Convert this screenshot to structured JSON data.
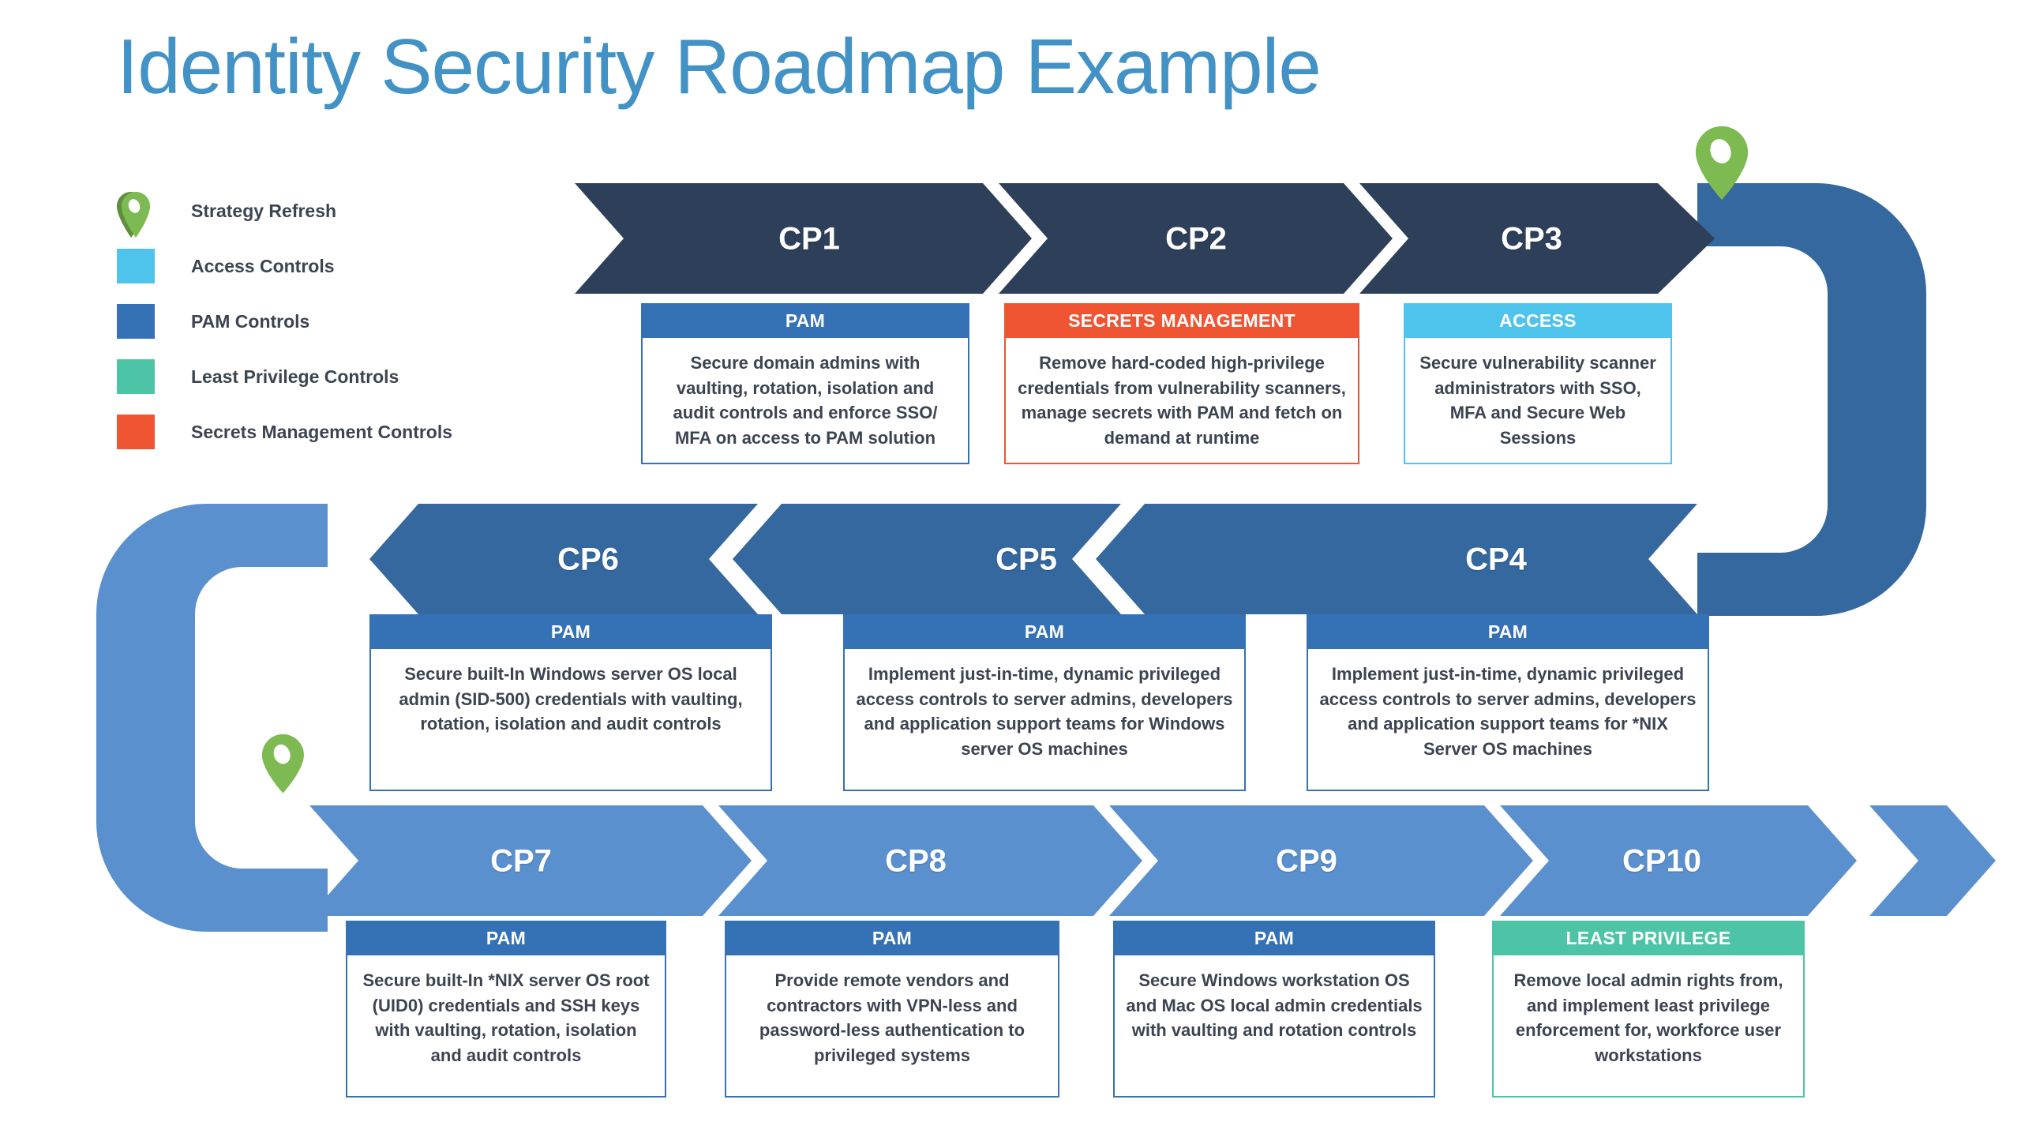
{
  "page": {
    "title": "Identity Security Roadmap Example",
    "title_color": "#4292c6",
    "background": "#ffffff"
  },
  "legend": {
    "items": [
      {
        "label": "Strategy Refresh",
        "icon": "map-pin-icon",
        "color": "#6aa84f",
        "shape": "pin"
      },
      {
        "label": "Access Controls",
        "icon": "color-swatch-icon",
        "color": "#4ec3ec",
        "shape": "square"
      },
      {
        "label": "PAM Controls",
        "icon": "color-swatch-icon",
        "color": "#3571b5",
        "shape": "square"
      },
      {
        "label": "Least Privilege Controls",
        "icon": "color-swatch-icon",
        "color": "#4ec4a6",
        "shape": "square"
      },
      {
        "label": "Secrets Management Controls",
        "icon": "color-swatch-icon",
        "color": "#ef5533",
        "shape": "square"
      }
    ]
  },
  "colors": {
    "row1_arrow": "#2e4059",
    "row2_arrow": "#35689e",
    "row3_arrow": "#5b90ce",
    "connector_right": "#35689e",
    "connector_left": "#5b90ce",
    "pam": "#3571b5",
    "access": "#4ec3ec",
    "secrets": "#ef5533",
    "least_privilege": "#4ec4a6",
    "body_text": "#3d4451"
  },
  "rows": [
    {
      "name": "row-1",
      "direction": "right",
      "arrow_color": "#2e4059",
      "steps": [
        {
          "id": "CP1",
          "card": {
            "header": "PAM",
            "category": "pam",
            "color": "#3571b5",
            "text": "Secure domain admins with vaulting, rotation, isolation and audit controls and enforce SSO/ MFA on access to PAM solution"
          }
        },
        {
          "id": "CP2",
          "card": {
            "header": "SECRETS MANAGEMENT",
            "category": "secrets",
            "color": "#ef5533",
            "text": "Remove hard-coded high-privilege credentials from vulnerability scanners, manage secrets with PAM and fetch on demand at runtime"
          }
        },
        {
          "id": "CP3",
          "card": {
            "header": "ACCESS",
            "category": "access",
            "color": "#4ec3ec",
            "text": "Secure vulnerability scanner administrators with SSO, MFA and Secure Web Sessions"
          }
        }
      ]
    },
    {
      "name": "row-2",
      "direction": "left",
      "arrow_color": "#35689e",
      "steps": [
        {
          "id": "CP6",
          "card": {
            "header": "PAM",
            "category": "pam",
            "color": "#3571b5",
            "text": "Secure built-In Windows server OS local admin (SID-500) credentials with vaulting, rotation, isolation and audit controls"
          }
        },
        {
          "id": "CP5",
          "card": {
            "header": "PAM",
            "category": "pam",
            "color": "#3571b5",
            "text": "Implement just-in-time, dynamic privileged access controls to server admins, developers and application support teams for Windows server OS machines"
          }
        },
        {
          "id": "CP4",
          "card": {
            "header": "PAM",
            "category": "pam",
            "color": "#3571b5",
            "text": "Implement just-in-time, dynamic privileged access controls to server admins, developers and application support teams for *NIX Server OS machines"
          }
        }
      ]
    },
    {
      "name": "row-3",
      "direction": "right",
      "arrow_color": "#5b90ce",
      "steps": [
        {
          "id": "CP7",
          "card": {
            "header": "PAM",
            "category": "pam",
            "color": "#3571b5",
            "text": "Secure built-In *NIX server OS root (UID0) credentials and SSH keys with vaulting, rotation, isolation and audit controls"
          }
        },
        {
          "id": "CP8",
          "card": {
            "header": "PAM",
            "category": "pam",
            "color": "#3571b5",
            "text": "Provide remote vendors and contractors with VPN-less and password-less authentication to privileged systems"
          }
        },
        {
          "id": "CP9",
          "card": {
            "header": "PAM",
            "category": "pam",
            "color": "#3571b5",
            "text": "Secure Windows workstation OS and Mac OS local admin credentials with vaulting and rotation controls"
          }
        },
        {
          "id": "CP10",
          "card": {
            "header": "LEAST PRIVILEGE",
            "category": "least_privilege",
            "color": "#4ec4a6",
            "text": "Remove local admin rights from, and implement least privilege enforcement for, workforce user workstations"
          }
        }
      ]
    }
  ],
  "markers": [
    {
      "name": "strategy-refresh-marker-cp3",
      "icon": "map-pin-icon",
      "color": "#6aa84f"
    },
    {
      "name": "strategy-refresh-marker-cp7",
      "icon": "map-pin-icon",
      "color": "#6aa84f"
    }
  ]
}
